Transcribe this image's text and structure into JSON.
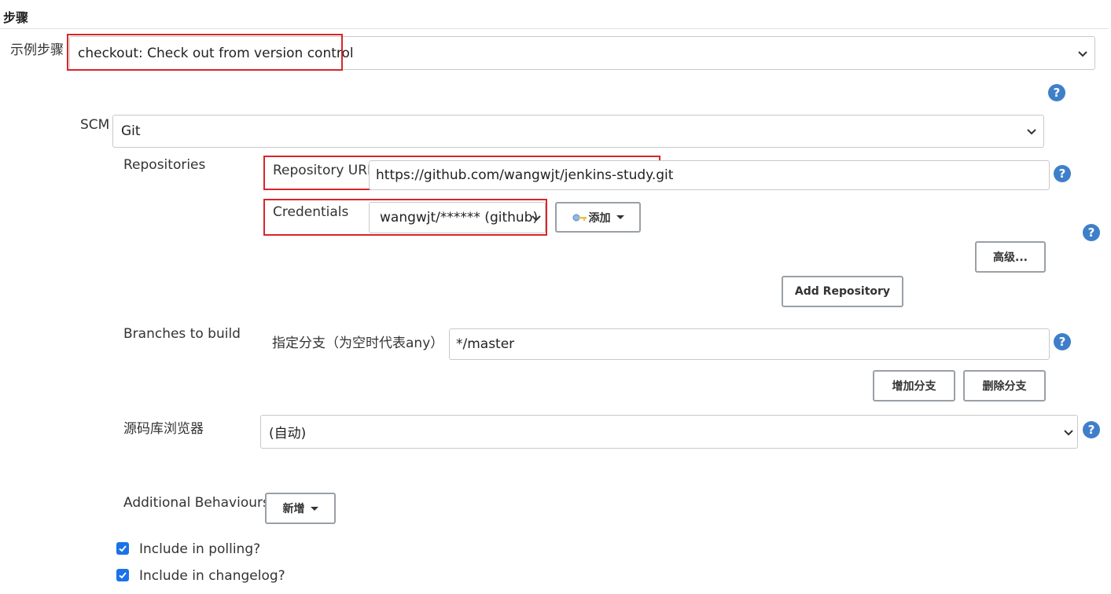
{
  "section": {
    "title": "步骤"
  },
  "sample_step": {
    "label": "示例步骤",
    "value": "checkout: Check out from version control"
  },
  "scm": {
    "label": "SCM",
    "value": "Git"
  },
  "repositories": {
    "label": "Repositories",
    "url_label": "Repository URL",
    "url_value": "https://github.com/wangwjt/jenkins-study.git",
    "credentials_label": "Credentials",
    "credentials_value": "wangwjt/****** (github)",
    "add_label": "添加",
    "advanced_label": "高级...",
    "add_repository_label": "Add Repository"
  },
  "branches": {
    "label": "Branches to build",
    "specifier_label": "指定分支（为空时代表any）",
    "specifier_value": "*/master",
    "add_branch_label": "增加分支",
    "delete_branch_label": "删除分支"
  },
  "browser": {
    "label": "源码库浏览器",
    "value": "(自动)"
  },
  "behaviours": {
    "label": "Additional Behaviours",
    "add_label": "新增"
  },
  "options": {
    "include_polling": "Include in polling?",
    "include_changelog": "Include in changelog?"
  },
  "help_icon_text": "?",
  "colors": {
    "accent": "#3f7fc9",
    "highlight": "#d7262b",
    "checkbox": "#1a73e8"
  }
}
